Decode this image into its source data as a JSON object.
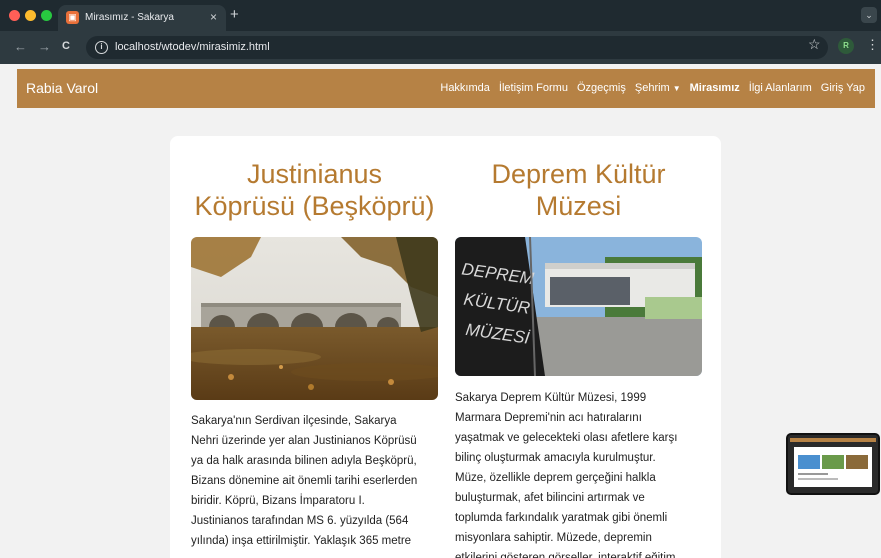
{
  "browser": {
    "tab_title": "Mirasımız - Sakarya",
    "tab_close": "×",
    "new_tab": "+",
    "url": "localhost/wtodev/mirasimiz.html",
    "profile_initial": "R"
  },
  "site": {
    "brand": "Rabia Varol",
    "nav": [
      {
        "label": "Hakkımda"
      },
      {
        "label": "İletişim Formu"
      },
      {
        "label": "Özgeçmiş"
      },
      {
        "label": "Şehrim"
      },
      {
        "label": "Mirasımız"
      },
      {
        "label": "İlgi Alanlarım"
      },
      {
        "label": "Giriş Yap"
      }
    ],
    "nav_dropdown_caret": "▼"
  },
  "cards": {
    "left": {
      "title_line1": "Justinianus",
      "title_line2": "Köprüsü (Beşköprü)",
      "text_lines": [
        "Sakarya'nın Serdivan ilçesinde, Sakarya",
        "Nehri üzerinde yer alan Justinianos Köprüsü",
        "ya da halk arasında bilinen adıyla Beşköprü,",
        "Bizans dönemine ait önemli tarihi eserlerden",
        "biridir. Köprü, Bizans İmparatoru I.",
        "Justinianos tarafından MS 6. yüzyılda (564",
        "yılında) inşa ettirilmiştir. Yaklaşık 365 metre"
      ]
    },
    "right": {
      "title_line1": "Deprem Kültür",
      "title_line2": "Müzesi",
      "image_sign_text": "DEPREM KÜLTÜR MÜZESİ",
      "text_lines": [
        "Sakarya Deprem Kültür Müzesi, 1999",
        "Marmara Depremi'nin acı hatıralarını",
        "yaşatmak ve gelecekteki olası afetlere karşı",
        "bilinç oluşturmak amacıyla kurulmuştur.",
        "Müze, özellikle deprem gerçeğini halkla",
        "buluşturmak, afet bilincini artırmak ve",
        "toplumda farkındalık yaratmak gibi önemli",
        "misyonlara sahiptir. Müzede, depremin",
        "etkilerini gösteren görseller, interaktif eğitim"
      ]
    }
  },
  "colors": {
    "brand": "#b68245",
    "heading": "#b57a30",
    "chrome_dark": "#1f2a30",
    "chrome": "#2e3a40"
  },
  "icons": {
    "back": "←",
    "forward": "→",
    "reload": "C",
    "info": "i",
    "star": "☆",
    "menu": "⋮",
    "tab_menu": "⌄"
  }
}
